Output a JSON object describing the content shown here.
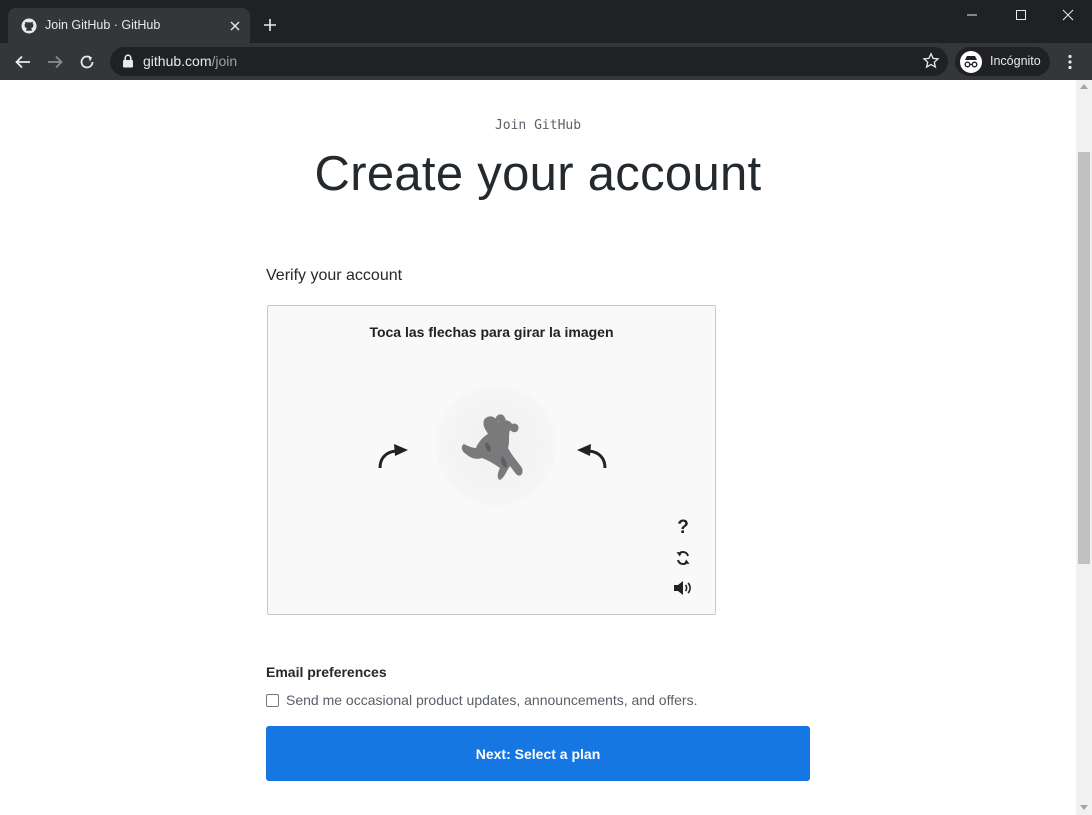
{
  "browser": {
    "tab": {
      "title": "Join GitHub · GitHub"
    },
    "address": {
      "host": "github.com",
      "path": "/join"
    },
    "profile": {
      "label": "Incógnito"
    }
  },
  "page": {
    "eyebrow": "Join GitHub",
    "headline": "Create your account",
    "verify": {
      "label": "Verify your account",
      "captcha": {
        "instruction": "Toca las flechas para girar la imagen",
        "help_glyph": "?"
      }
    },
    "email": {
      "heading": "Email preferences",
      "checkbox_label": "Send me occasional product updates, announcements, and offers.",
      "checked": false
    },
    "next_button": "Next: Select a plan"
  },
  "colors": {
    "chrome_dark": "#202124",
    "chrome_toolbar": "#35363a",
    "primary_button": "#1676e2",
    "heading_text": "#24292e"
  }
}
